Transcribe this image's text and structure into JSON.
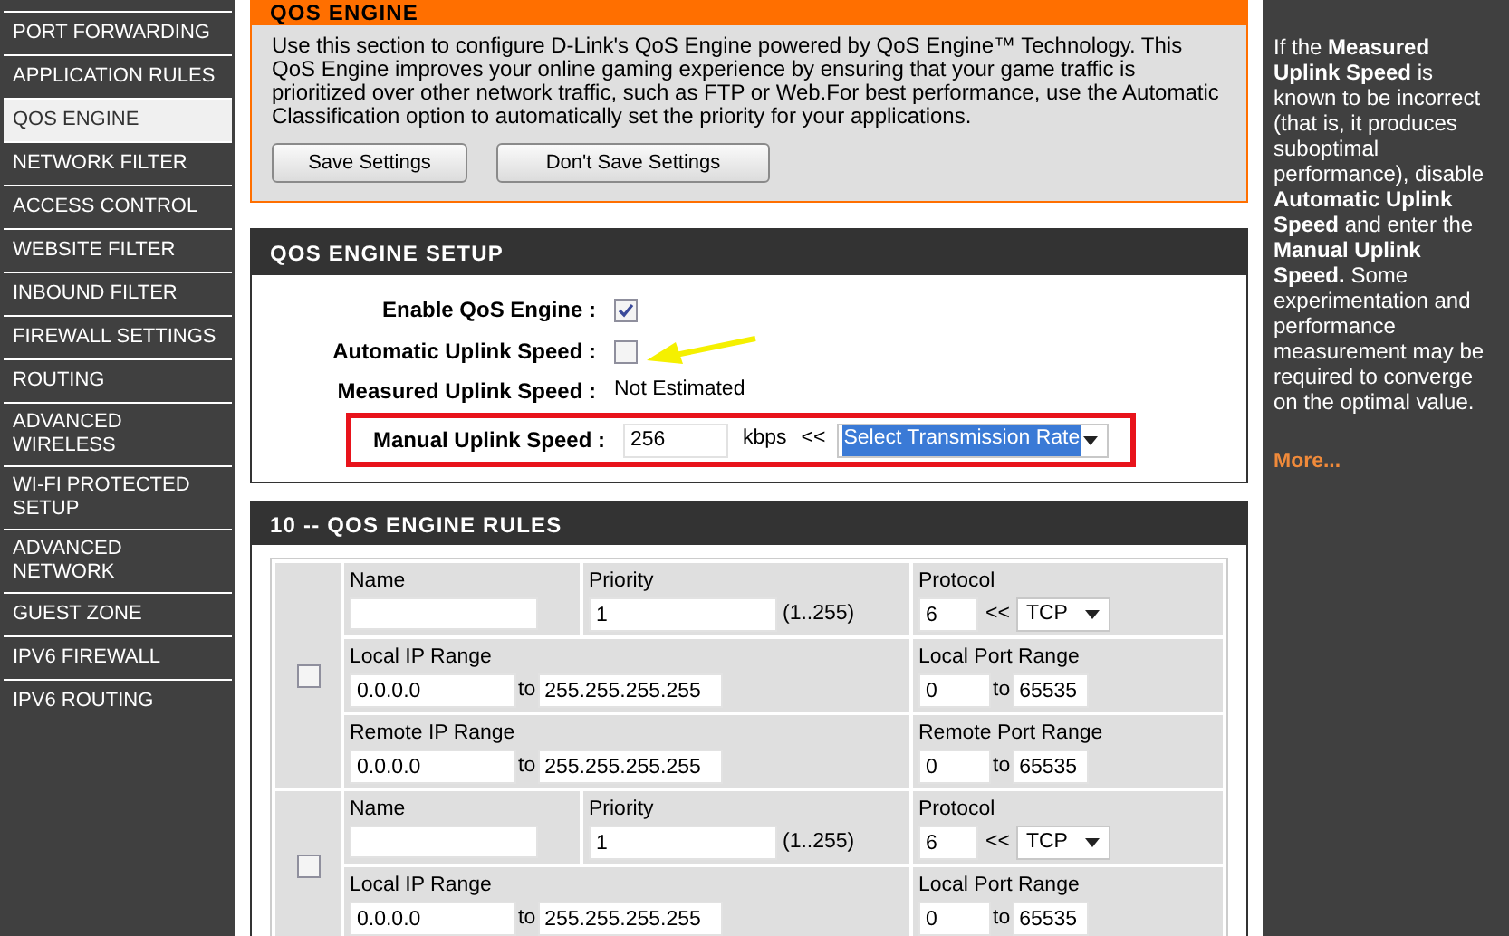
{
  "sidebar": {
    "items": [
      {
        "label": "PORT FORWARDING",
        "selected": false
      },
      {
        "label": "APPLICATION RULES",
        "selected": false
      },
      {
        "label": "QOS ENGINE",
        "selected": true
      },
      {
        "label": "NETWORK FILTER",
        "selected": false
      },
      {
        "label": "ACCESS CONTROL",
        "selected": false
      },
      {
        "label": "WEBSITE FILTER",
        "selected": false
      },
      {
        "label": "INBOUND FILTER",
        "selected": false
      },
      {
        "label": "FIREWALL SETTINGS",
        "selected": false
      },
      {
        "label": "ROUTING",
        "selected": false
      },
      {
        "label": "ADVANCED WIRELESS",
        "selected": false
      },
      {
        "label": "WI-FI PROTECTED SETUP",
        "selected": false
      },
      {
        "label": "ADVANCED NETWORK",
        "selected": false
      },
      {
        "label": "GUEST ZONE",
        "selected": false
      },
      {
        "label": "IPV6 FIREWALL",
        "selected": false
      },
      {
        "label": "IPV6 ROUTING",
        "selected": false
      }
    ]
  },
  "intro": {
    "title": "QOS ENGINE",
    "text": "Use this section to configure D-Link's QoS Engine powered by QoS Engine™ Technology. This QoS Engine improves your online gaming experience by ensuring that your game traffic is prioritized over other network traffic, such as FTP or Web.For best performance, use the Automatic Classification option to automatically set the priority for your applications.",
    "buttons": [
      "Save Settings",
      "Don't Save Settings"
    ]
  },
  "setup": {
    "title": "QOS ENGINE SETUP",
    "enable": {
      "label": "Enable QoS Engine :",
      "checked": true
    },
    "automatic": {
      "label": "Automatic Uplink Speed :",
      "checked": false
    },
    "measured": {
      "label": "Measured Uplink Speed :",
      "value": "Not Estimated"
    },
    "manual": {
      "label": "Manual Uplink Speed :",
      "value": "256",
      "unit": "kbps",
      "arrow": "<<",
      "select": "Select Transmission Rate"
    }
  },
  "rules": {
    "title": "10 -- QOS ENGINE RULES",
    "items": [
      {
        "checked": false,
        "name": {
          "label": "Name"
        },
        "priority": {
          "label": "Priority",
          "value": "1",
          "range": "(1..255)"
        },
        "protocol": {
          "label": "Protocol",
          "value": "6",
          "arrow": "<<",
          "select": "TCP"
        },
        "local_ip": {
          "label": "Local IP Range",
          "from": "0.0.0.0",
          "word": "to",
          "to": "255.255.255.255"
        },
        "local_port": {
          "label": "Local Port Range",
          "from": "0",
          "word": "to",
          "to": "65535"
        },
        "remote_ip": {
          "label": "Remote IP Range",
          "from": "0.0.0.0",
          "word": "to",
          "to": "255.255.255.255"
        },
        "remote_port": {
          "label": "Remote Port Range",
          "from": "0",
          "word": "to",
          "to": "65535"
        }
      },
      {
        "checked": false,
        "name": {
          "label": "Name"
        },
        "priority": {
          "label": "Priority",
          "value": "1",
          "range": "(1..255)"
        },
        "protocol": {
          "label": "Protocol",
          "value": "6",
          "arrow": "<<",
          "select": "TCP"
        },
        "local_ip": {
          "label": "Local IP Range",
          "from": "0.0.0.0",
          "word": "to",
          "to": "255.255.255.255"
        },
        "local_port": {
          "label": "Local Port Range",
          "from": "0",
          "word": "to",
          "to": "65535"
        }
      }
    ]
  },
  "help": {
    "text": "If the **Measured Uplink Speed** is known to be incorrect (that is, it produces suboptimal performance), disable **Automatic Uplink Speed** and enter the **Manual Uplink Speed.** Some experimentation and performance measurement may be required to converge on the optimal value.",
    "link": "More..."
  }
}
